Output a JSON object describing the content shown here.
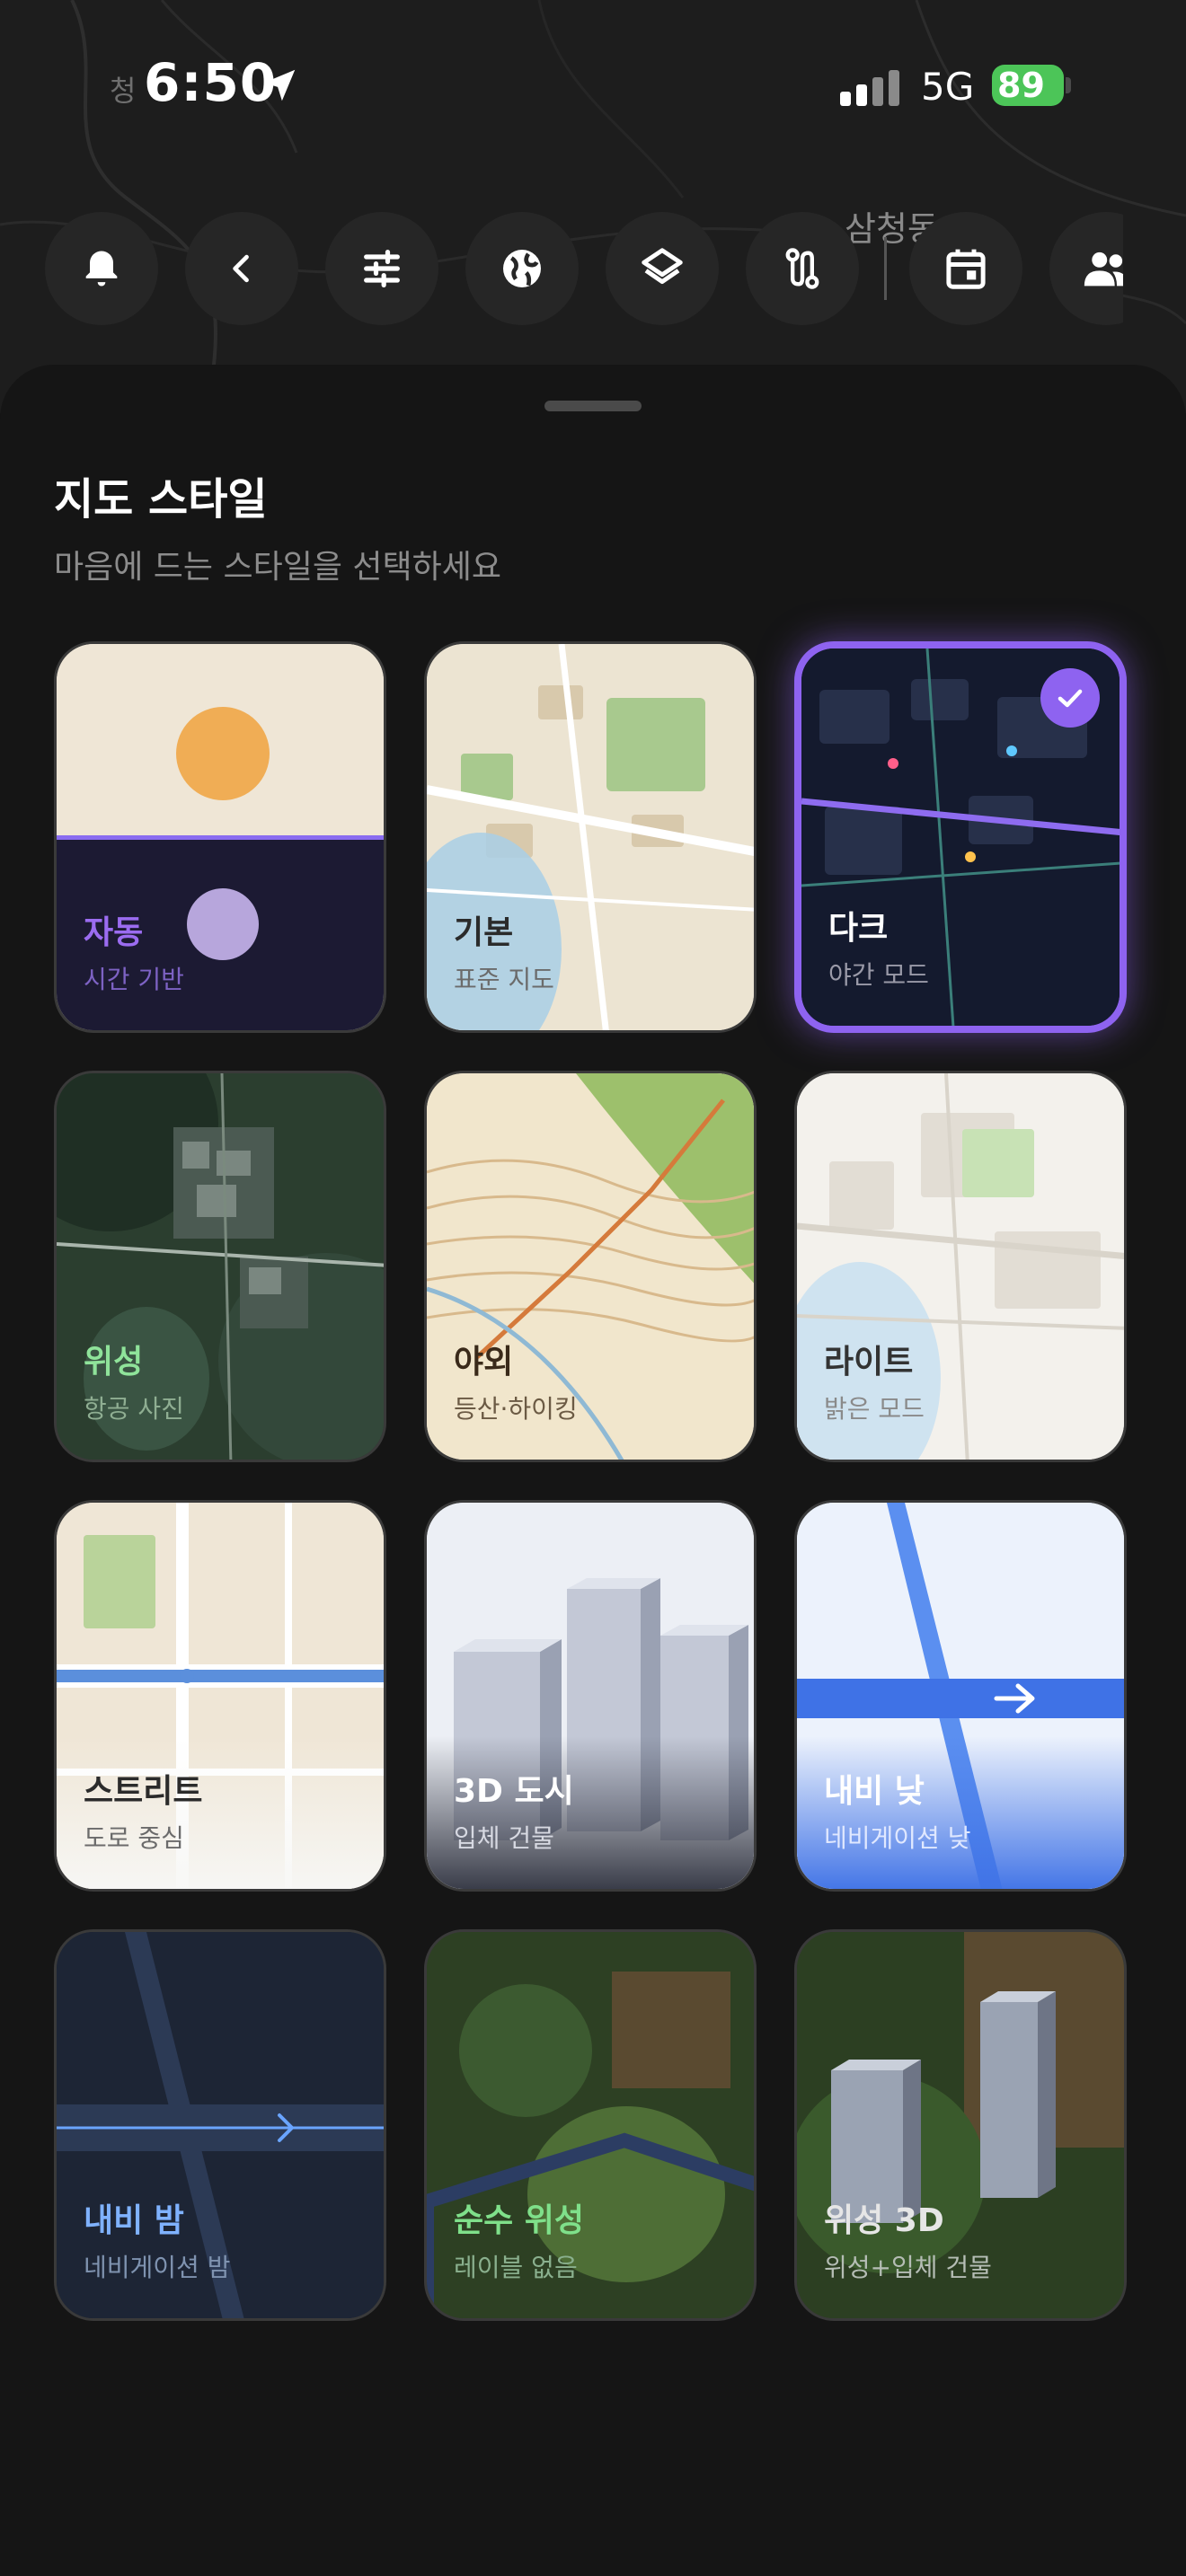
{
  "status_bar": {
    "time": "6:50",
    "network": "5G",
    "battery": "89"
  },
  "map_labels": {
    "a": "청",
    "b": "삼청동"
  },
  "toolbar": {
    "icons": [
      "bell-icon",
      "back-icon",
      "sliders-icon",
      "globe-icon",
      "layers-icon",
      "route-icon",
      "calendar-icon",
      "people-icon"
    ]
  },
  "sheet": {
    "title": "지도 스타일",
    "subtitle": "마음에 드는 스타일을 선택하세요",
    "selected_style": "다크",
    "styles": [
      {
        "label": "자동",
        "sub": "시간 기반",
        "label_color": "#9b6cf0",
        "sub_color": "#7d62c4"
      },
      {
        "label": "기본",
        "sub": "표준 지도",
        "label_color": "#2b2b2b",
        "sub_color": "#6b6b6b"
      },
      {
        "label": "다크",
        "sub": "야간 모드",
        "label_color": "#ffffff",
        "sub_color": "#9a9aa8"
      },
      {
        "label": "위성",
        "sub": "항공 사진",
        "label_color": "#8fe39a",
        "sub_color": "#8fae92"
      },
      {
        "label": "야외",
        "sub": "등산·하이킹",
        "label_color": "#3a2a1a",
        "sub_color": "#6b5a44"
      },
      {
        "label": "라이트",
        "sub": "밝은 모드",
        "label_color": "#333333",
        "sub_color": "#8a8a8a"
      },
      {
        "label": "스트리트",
        "sub": "도로 중심",
        "label_color": "#2b2b2b",
        "sub_color": "#6b6b6b"
      },
      {
        "label": "3D 도시",
        "sub": "입체 건물",
        "label_color": "#ffffff",
        "sub_color": "#d7d9e2"
      },
      {
        "label": "내비 낮",
        "sub": "네비게이션 낮",
        "label_color": "#ffffff",
        "sub_color": "#e0e8ff"
      },
      {
        "label": "내비 밤",
        "sub": "네비게이션 밤",
        "label_color": "#7fb2ff",
        "sub_color": "#7f93b0"
      },
      {
        "label": "순수 위성",
        "sub": "레이블 없음",
        "label_color": "#7fe08a",
        "sub_color": "#8ab08e"
      },
      {
        "label": "위성 3D",
        "sub": "위성+입체 건물",
        "label_color": "#e6e6e6",
        "sub_color": "#b5bdb5"
      }
    ]
  }
}
